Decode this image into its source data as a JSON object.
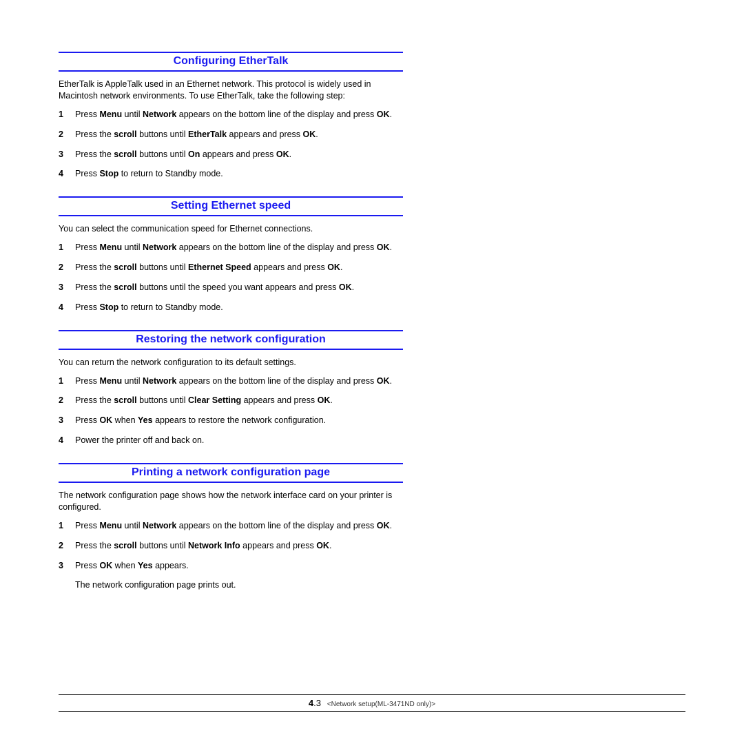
{
  "sections": [
    {
      "title": "Configuring EtherTalk",
      "intro": "EtherTalk is AppleTalk used in an Ethernet network. This protocol is widely used in Macintosh network environments. To use EtherTalk, take the following step:",
      "steps": [
        {
          "n": "1",
          "html": "Press <b>Menu</b> until <b>Network</b> appears on the bottom line of the display and press <b>OK</b>."
        },
        {
          "n": "2",
          "html": "Press the <b>scroll</b> buttons until <b>EtherTalk</b> appears and press <b>OK</b>."
        },
        {
          "n": "3",
          "html": "Press the <b>scroll</b> buttons until <b>On</b> appears and press <b>OK</b>."
        },
        {
          "n": "4",
          "html": "Press <b>Stop</b> to return to Standby mode."
        }
      ]
    },
    {
      "title": "Setting Ethernet speed",
      "intro": "You can select the communication speed for Ethernet connections.",
      "steps": [
        {
          "n": "1",
          "html": "Press <b>Menu</b> until <b>Network</b> appears on the bottom line of the display and press <b>OK</b>."
        },
        {
          "n": "2",
          "html": "Press the <b>scroll</b> buttons until <b>Ethernet Speed</b> appears and press <b>OK</b>."
        },
        {
          "n": "3",
          "html": "Press the <b>scroll</b> buttons until the speed you want appears and press <b>OK</b>."
        },
        {
          "n": "4",
          "html": "Press <b>Stop</b> to return to Standby mode."
        }
      ]
    },
    {
      "title": "Restoring the network configuration",
      "intro": "You can return the network configuration to its default settings.",
      "steps": [
        {
          "n": "1",
          "html": "Press <b>Menu</b> until <b>Network</b> appears on the bottom line of the display and press <b>OK</b>."
        },
        {
          "n": "2",
          "html": "Press the <b>scroll</b> buttons until <b>Clear Setting</b> appears and press <b>OK</b>."
        },
        {
          "n": "3",
          "html": "Press <b>OK</b> when <b>Yes</b> appears to restore the network configuration."
        },
        {
          "n": "4",
          "html": "Power the printer off and back on."
        }
      ]
    },
    {
      "title": "Printing a network configuration page",
      "intro": "The network configuration page shows how the network interface card on your printer is configured.",
      "steps": [
        {
          "n": "1",
          "html": "Press <b>Menu</b> until <b>Network</b> appears on the bottom line of the display and press <b>OK</b>."
        },
        {
          "n": "2",
          "html": "Press the <b>scroll</b> buttons until <b>Network Info</b> appears and press <b>OK</b>."
        },
        {
          "n": "3",
          "html": "Press <b>OK</b> when <b>Yes</b> appears."
        }
      ],
      "trailing": "The network configuration page prints out."
    }
  ],
  "footer": {
    "chapter": "4",
    "page": ".3",
    "label": "<Network setup(ML-3471ND only)>"
  }
}
